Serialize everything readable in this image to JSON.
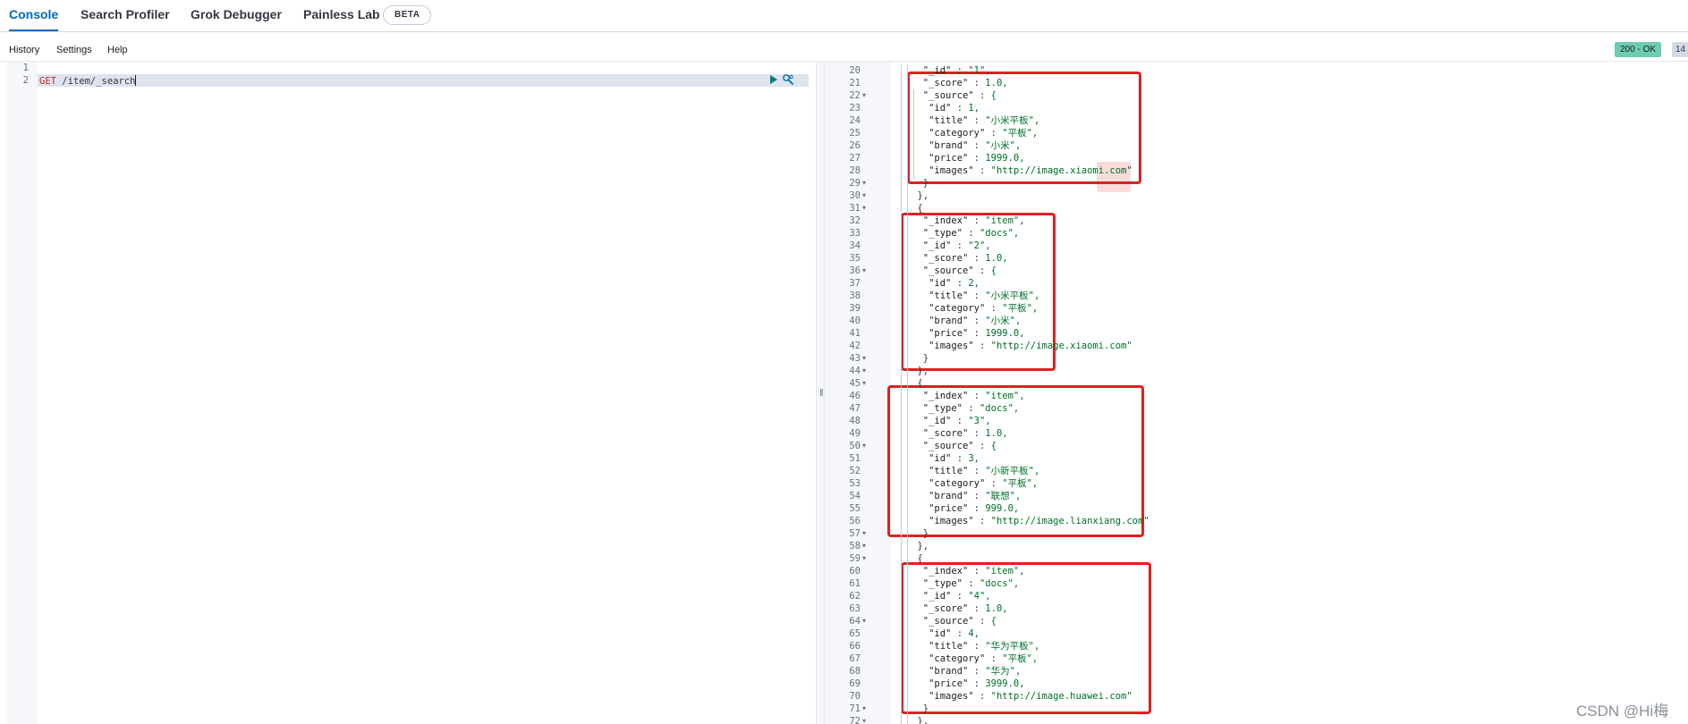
{
  "tabs": {
    "console": "Console",
    "search_profiler": "Search Profiler",
    "grok_debugger": "Grok Debugger",
    "painless_lab": "Painless Lab",
    "beta_badge": "BETA"
  },
  "submenu": {
    "history": "History",
    "settings": "Settings",
    "help": "Help"
  },
  "status": {
    "code": "200 - OK",
    "time": "14"
  },
  "request": {
    "line_numbers": [
      "1",
      "2"
    ],
    "method": "GET",
    "path": "/item/_search"
  },
  "divider_grip": "‖",
  "response_lines": [
    {
      "n": "20",
      "indent": 5,
      "text": "\"_id\" : \"1\",",
      "fold": false
    },
    {
      "n": "21",
      "indent": 5,
      "text": "\"_score\" : 1.0,",
      "fold": false
    },
    {
      "n": "22",
      "indent": 5,
      "text": "\"_source\" : {",
      "fold": true
    },
    {
      "n": "23",
      "indent": 6,
      "text": "\"id\" : 1,",
      "fold": false
    },
    {
      "n": "24",
      "indent": 6,
      "text": "\"title\" : \"小米平板\",",
      "fold": false
    },
    {
      "n": "25",
      "indent": 6,
      "text": "\"category\" : \"平板\",",
      "fold": false
    },
    {
      "n": "26",
      "indent": 6,
      "text": "\"brand\" : \"小米\",",
      "fold": false
    },
    {
      "n": "27",
      "indent": 6,
      "text": "\"price\" : 1999.0,",
      "fold": false
    },
    {
      "n": "28",
      "indent": 6,
      "text": "\"images\" : \"http://image.xiaomi.com\"",
      "fold": false
    },
    {
      "n": "29",
      "indent": 5,
      "text": "}",
      "fold": true
    },
    {
      "n": "30",
      "indent": 4,
      "text": "},",
      "fold": true
    },
    {
      "n": "31",
      "indent": 4,
      "text": "{",
      "fold": true
    },
    {
      "n": "32",
      "indent": 5,
      "text": "\"_index\" : \"item\",",
      "fold": false
    },
    {
      "n": "33",
      "indent": 5,
      "text": "\"_type\" : \"docs\",",
      "fold": false
    },
    {
      "n": "34",
      "indent": 5,
      "text": "\"_id\" : \"2\",",
      "fold": false
    },
    {
      "n": "35",
      "indent": 5,
      "text": "\"_score\" : 1.0,",
      "fold": false
    },
    {
      "n": "36",
      "indent": 5,
      "text": "\"_source\" : {",
      "fold": true
    },
    {
      "n": "37",
      "indent": 6,
      "text": "\"id\" : 2,",
      "fold": false
    },
    {
      "n": "38",
      "indent": 6,
      "text": "\"title\" : \"小米平板\",",
      "fold": false
    },
    {
      "n": "39",
      "indent": 6,
      "text": "\"category\" : \"平板\",",
      "fold": false
    },
    {
      "n": "40",
      "indent": 6,
      "text": "\"brand\" : \"小米\",",
      "fold": false
    },
    {
      "n": "41",
      "indent": 6,
      "text": "\"price\" : 1999.0,",
      "fold": false
    },
    {
      "n": "42",
      "indent": 6,
      "text": "\"images\" : \"http://image.xiaomi.com\"",
      "fold": false
    },
    {
      "n": "43",
      "indent": 5,
      "text": "}",
      "fold": true
    },
    {
      "n": "44",
      "indent": 4,
      "text": "},",
      "fold": true
    },
    {
      "n": "45",
      "indent": 4,
      "text": "{",
      "fold": true
    },
    {
      "n": "46",
      "indent": 5,
      "text": "\"_index\" : \"item\",",
      "fold": false
    },
    {
      "n": "47",
      "indent": 5,
      "text": "\"_type\" : \"docs\",",
      "fold": false
    },
    {
      "n": "48",
      "indent": 5,
      "text": "\"_id\" : \"3\",",
      "fold": false
    },
    {
      "n": "49",
      "indent": 5,
      "text": "\"_score\" : 1.0,",
      "fold": false
    },
    {
      "n": "50",
      "indent": 5,
      "text": "\"_source\" : {",
      "fold": true
    },
    {
      "n": "51",
      "indent": 6,
      "text": "\"id\" : 3,",
      "fold": false
    },
    {
      "n": "52",
      "indent": 6,
      "text": "\"title\" : \"小新平板\",",
      "fold": false
    },
    {
      "n": "53",
      "indent": 6,
      "text": "\"category\" : \"平板\",",
      "fold": false
    },
    {
      "n": "54",
      "indent": 6,
      "text": "\"brand\" : \"联想\",",
      "fold": false
    },
    {
      "n": "55",
      "indent": 6,
      "text": "\"price\" : 999.0,",
      "fold": false
    },
    {
      "n": "56",
      "indent": 6,
      "text": "\"images\" : \"http://image.lianxiang.com\"",
      "fold": false
    },
    {
      "n": "57",
      "indent": 5,
      "text": "}",
      "fold": true
    },
    {
      "n": "58",
      "indent": 4,
      "text": "},",
      "fold": true
    },
    {
      "n": "59",
      "indent": 4,
      "text": "{",
      "fold": true
    },
    {
      "n": "60",
      "indent": 5,
      "text": "\"_index\" : \"item\",",
      "fold": false
    },
    {
      "n": "61",
      "indent": 5,
      "text": "\"_type\" : \"docs\",",
      "fold": false
    },
    {
      "n": "62",
      "indent": 5,
      "text": "\"_id\" : \"4\",",
      "fold": false
    },
    {
      "n": "63",
      "indent": 5,
      "text": "\"_score\" : 1.0,",
      "fold": false
    },
    {
      "n": "64",
      "indent": 5,
      "text": "\"_source\" : {",
      "fold": true
    },
    {
      "n": "65",
      "indent": 6,
      "text": "\"id\" : 4,",
      "fold": false
    },
    {
      "n": "66",
      "indent": 6,
      "text": "\"title\" : \"华为平板\",",
      "fold": false
    },
    {
      "n": "67",
      "indent": 6,
      "text": "\"category\" : \"平板\",",
      "fold": false
    },
    {
      "n": "68",
      "indent": 6,
      "text": "\"brand\" : \"华为\",",
      "fold": false
    },
    {
      "n": "69",
      "indent": 6,
      "text": "\"price\" : 3999.0,",
      "fold": false
    },
    {
      "n": "70",
      "indent": 6,
      "text": "\"images\" : \"http://image.huawei.com\"",
      "fold": false
    },
    {
      "n": "71",
      "indent": 5,
      "text": "}",
      "fold": true
    },
    {
      "n": "72",
      "indent": 4,
      "text": "},",
      "fold": true
    }
  ],
  "watermark": "CSDN @Hi梅",
  "colors": {
    "accent": "#006bb4",
    "status_ok": "#6dccb1",
    "annotation_red": "#e02020",
    "json_string": "#006e28",
    "method": "#c61e25"
  }
}
